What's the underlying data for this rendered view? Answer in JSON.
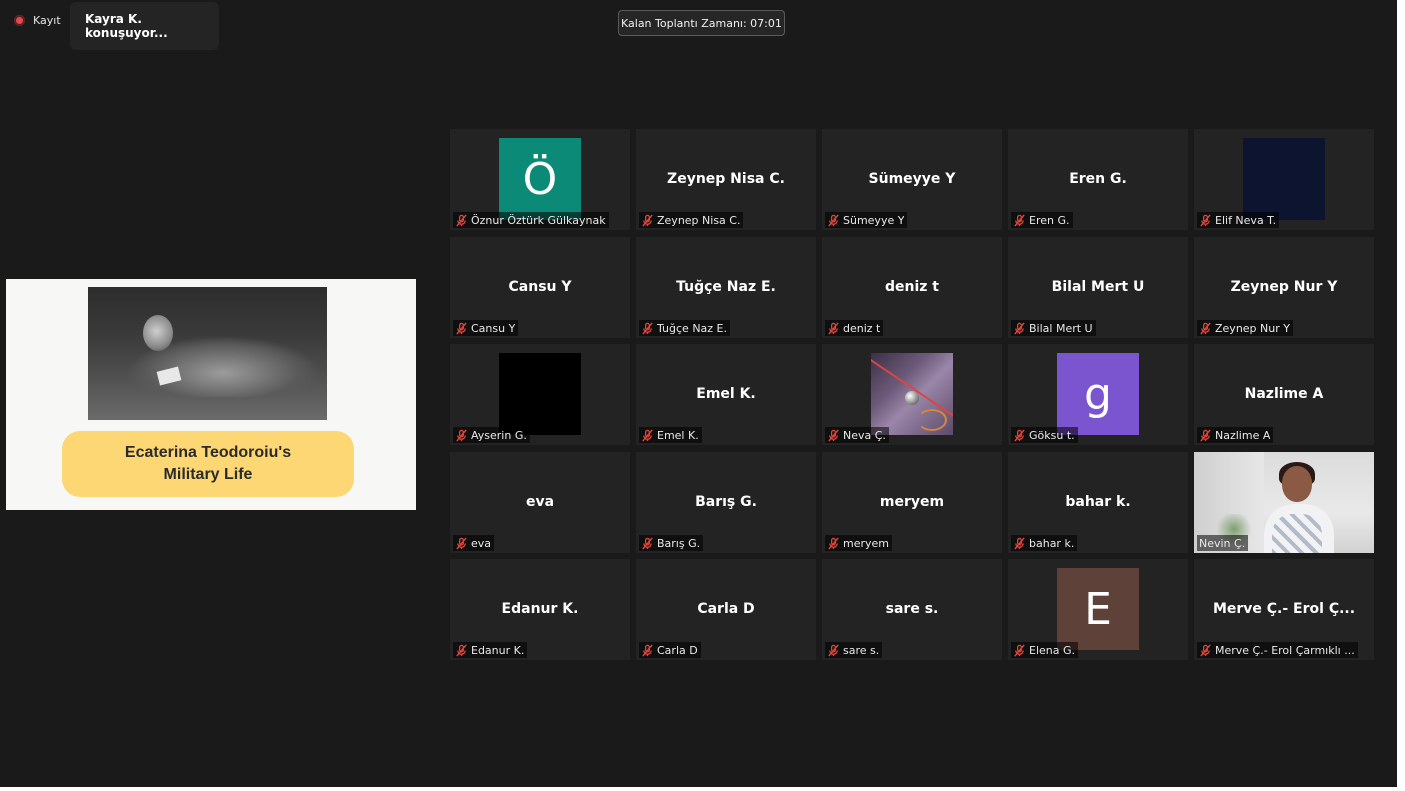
{
  "recording": {
    "label": "Kayıt"
  },
  "speaker": {
    "label": "Kayra K. konuşuyor..."
  },
  "timer": {
    "label": "Kalan Toplantı Zamanı: 07:01"
  },
  "shared_slide": {
    "title_line1": "Ecaterina Teodoroiu's",
    "title_line2": "Military Life"
  },
  "participants": [
    {
      "name": "Öznur Öztürk Gülkaynak",
      "tile": "",
      "avatar_letter": "Ö",
      "avatar_color": "#0c8a78"
    },
    {
      "name": "Zeynep Nisa C.",
      "tile": "Zeynep Nisa C."
    },
    {
      "name": "Sümeyye Y",
      "tile": "Sümeyye Y"
    },
    {
      "name": "Eren G.",
      "tile": "Eren G."
    },
    {
      "name": "Elif Neva T.",
      "tile": "",
      "avatar_color": "#0c1430"
    },
    {
      "name": "Cansu Y",
      "tile": "Cansu Y"
    },
    {
      "name": "Tuğçe Naz E.",
      "tile": "Tuğçe Naz E."
    },
    {
      "name": "deniz t",
      "tile": "deniz t"
    },
    {
      "name": "Bilal Mert U",
      "tile": "Bilal Mert U"
    },
    {
      "name": "Zeynep Nur Y",
      "tile": "Zeynep Nur Y"
    },
    {
      "name": "Ayserin G.",
      "tile": "",
      "avatar_color": "#000000"
    },
    {
      "name": "Emel K.",
      "tile": "Emel K."
    },
    {
      "name": "Neva Ç.",
      "tile": "",
      "album": true
    },
    {
      "name": "Göksu t.",
      "tile": "",
      "avatar_letter": "g",
      "avatar_color": "#7b55cf"
    },
    {
      "name": "Nazlime A",
      "tile": "Nazlime A"
    },
    {
      "name": "eva",
      "tile": "eva"
    },
    {
      "name": "Barış G.",
      "tile": "Barış G."
    },
    {
      "name": "meryem",
      "tile": "meryem"
    },
    {
      "name": "bahar k.",
      "tile": "bahar k."
    },
    {
      "name": "Nevin Ç.",
      "tile": "",
      "video": true,
      "mic_on": true
    },
    {
      "name": "Edanur K.",
      "tile": "Edanur K."
    },
    {
      "name": "Carla D",
      "tile": "Carla D"
    },
    {
      "name": "sare s.",
      "tile": "sare s."
    },
    {
      "name": "Elena G.",
      "tile": "",
      "avatar_letter": "E",
      "avatar_color": "#5e4138"
    },
    {
      "name": "Merve Ç.- Erol Çarmıklı ...",
      "tile": "Merve Ç.- Erol Ç..."
    }
  ]
}
